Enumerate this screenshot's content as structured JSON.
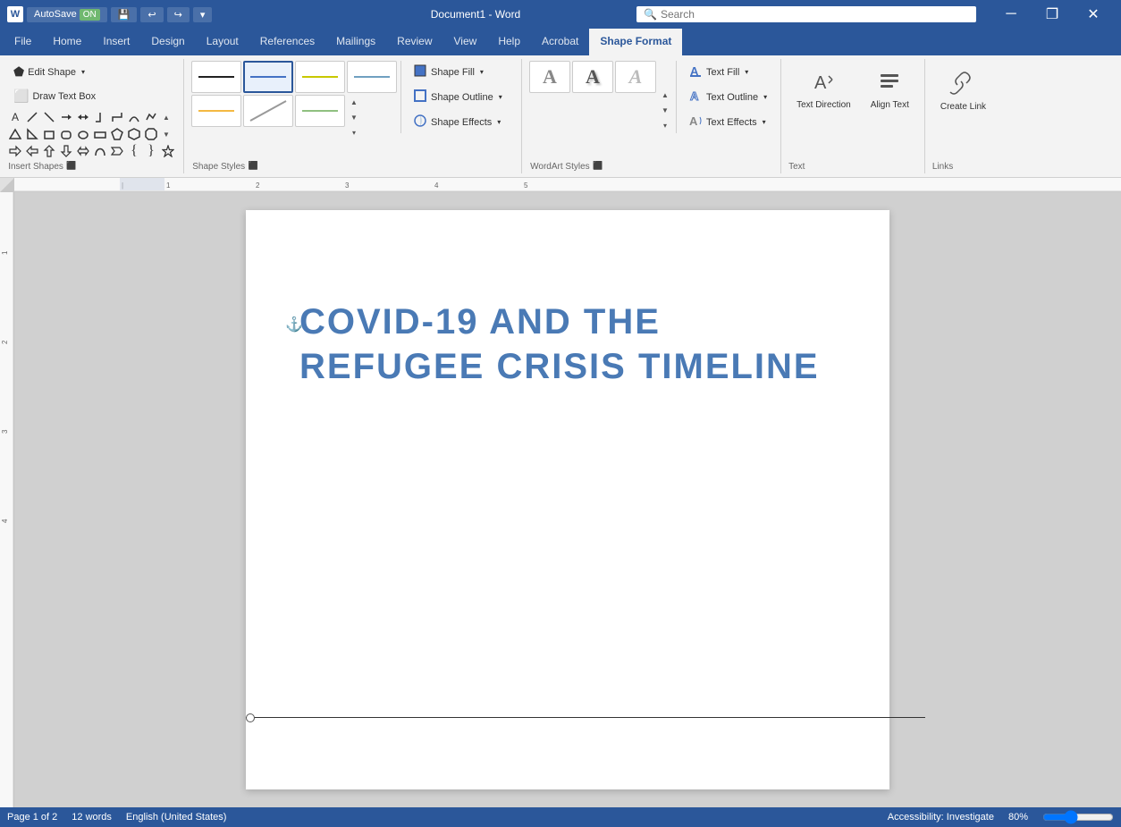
{
  "titlebar": {
    "autosave_label": "AutoSave",
    "autosave_on": "ON",
    "save_icon": "💾",
    "undo_icon": "↩",
    "redo_icon": "↪",
    "customize_icon": "▾",
    "title": "Document1 - Word",
    "search_placeholder": "Search",
    "minimize_icon": "─",
    "restore_icon": "❐",
    "close_icon": "✕"
  },
  "ribbon": {
    "active_tab": "Shape Format",
    "tabs": [
      "File",
      "Home",
      "Insert",
      "Design",
      "Layout",
      "References",
      "Mailings",
      "Review",
      "View",
      "Help",
      "Acrobat",
      "Shape Format"
    ],
    "groups": {
      "insert_shapes": {
        "label": "Insert Shapes",
        "edit_shape_label": "Edit Shape",
        "draw_text_box_label": "Draw Text Box"
      },
      "shape_styles": {
        "label": "Shape Styles",
        "shape_fill_label": "Shape Fill",
        "shape_outline_label": "Shape Outline",
        "shape_effects_label": "Shape Effects",
        "format_dialog_label": "Format Shape"
      },
      "wordart_styles": {
        "label": "WordArt Styles",
        "text_fill_label": "Text Fill",
        "text_outline_label": "Text Outline",
        "text_effects_label": "Text Effects",
        "format_dialog_label": "Format Shape"
      },
      "text": {
        "label": "Text",
        "text_direction_label": "Text Direction",
        "align_text_label": "Align Text"
      },
      "links": {
        "label": "Links",
        "create_link_label": "Create Link"
      }
    }
  },
  "document": {
    "title_line1": "COVID-19 AND THE",
    "title_line2": "REFUGEE CRISIS TIMELINE"
  },
  "wordart_swatches": [
    {
      "letter": "A",
      "color": "#888",
      "style": "plain"
    },
    {
      "letter": "A",
      "color": "#555",
      "style": "shadow"
    },
    {
      "letter": "A",
      "color": "#aaa",
      "style": "light"
    }
  ],
  "shape_styles_lines": [
    {
      "color": "#222",
      "width": 2,
      "dash": "none"
    },
    {
      "color": "#4472c4",
      "width": 2,
      "dash": "none"
    },
    {
      "color": "#f4b942",
      "width": 2,
      "dash": "none"
    },
    {
      "color": "#888",
      "width": 2,
      "dash": "diagonal"
    },
    {
      "color": "#c0c060",
      "width": 2,
      "dash": "none"
    },
    {
      "color": "#70a0c0",
      "width": 2,
      "dash": "none"
    },
    {
      "color": "#90c080",
      "width": 2,
      "dash": "none"
    }
  ]
}
